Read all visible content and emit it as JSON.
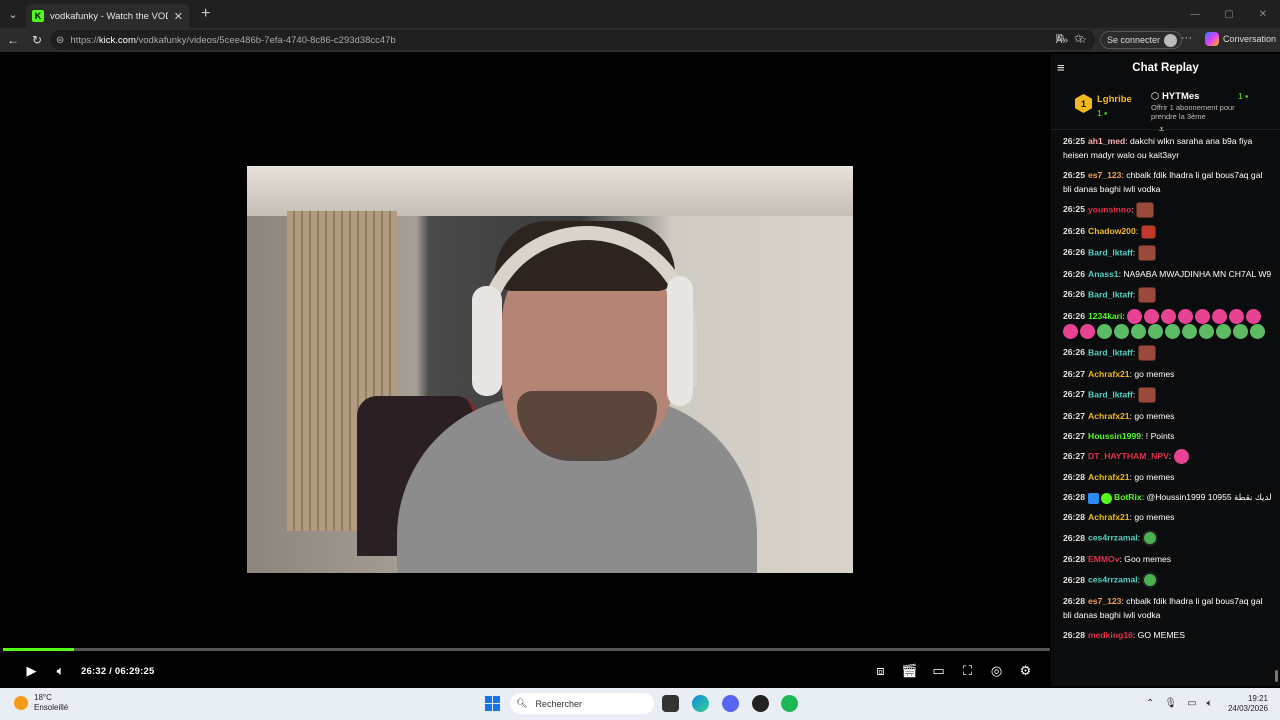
{
  "browser": {
    "tab_title": "vodkafunky - Watch the VOD on K",
    "tab_favicon": "K",
    "url_prefix": "https://",
    "url_domain": "kick.com",
    "url_path": "/vodkafunky/videos/5cee486b-7efa-4740-8c86-c293d38cc47b",
    "signin_label": "Se connecter",
    "copilot_label": "Conversation"
  },
  "player": {
    "current_time": "26:32",
    "separator": "/",
    "duration": "06:29:25",
    "progress_fraction": 0.068
  },
  "chat": {
    "title": "Chat Replay",
    "leaderboard": {
      "rank": "1",
      "name": "Lghribe",
      "count": "1"
    },
    "gifter": {
      "name": "HYTMes",
      "count": "1",
      "subtitle": "Offrir 1 abonnement pour prendre la 3ème"
    },
    "messages": [
      {
        "time": "26:25",
        "user": "ah1_med",
        "color": "#ffb0b0",
        "text": "dakchi wlkn saraha ana b9a fiya heisen madyr walo ou kait3ayr",
        "emotes": []
      },
      {
        "time": "26:25",
        "user": "es7_123",
        "color": "#f29d48",
        "text": "chbalk fdik lhadra li gal bous7aq gal bli danas baghi iwli vodka",
        "emotes": []
      },
      {
        "time": "26:25",
        "user": "younsinno",
        "color": "#e0304a",
        "text": "",
        "emotes": [
          "brown"
        ]
      },
      {
        "time": "26:26",
        "user": "Chadow200",
        "color": "#f2b81d",
        "text": "",
        "emotes": [
          "red"
        ]
      },
      {
        "time": "26:26",
        "user": "Bard_lktaff",
        "color": "#4fd1c5",
        "text": "",
        "emotes": [
          "brown"
        ]
      },
      {
        "time": "26:26",
        "user": "Anass1",
        "color": "#4fd1c5",
        "text": "NA9ABA MWAJDINHA MN CH7AL W9",
        "emotes": []
      },
      {
        "time": "26:26",
        "user": "Bard_lktaff",
        "color": "#4fd1c5",
        "text": "",
        "emotes": [
          "brown"
        ]
      },
      {
        "time": "26:26",
        "user": "1234kari",
        "color": "#53fc18",
        "text": "",
        "emotes": [
          "pink",
          "pink",
          "pink",
          "pink",
          "pink",
          "pink",
          "pink",
          "pink",
          "pink",
          "pink",
          "dollar",
          "dollar",
          "dollar",
          "dollar",
          "dollar",
          "dollar",
          "dollar",
          "dollar",
          "dollar",
          "dollar"
        ]
      },
      {
        "time": "26:26",
        "user": "Bard_lktaff",
        "color": "#4fd1c5",
        "text": "",
        "emotes": [
          "brown"
        ]
      },
      {
        "time": "26:27",
        "user": "Achrafx21",
        "color": "#f2b81d",
        "text": "go memes",
        "emotes": []
      },
      {
        "time": "26:27",
        "user": "Bard_lktaff",
        "color": "#4fd1c5",
        "text": "",
        "emotes": [
          "brown"
        ]
      },
      {
        "time": "26:27",
        "user": "Achrafx21",
        "color": "#f2b81d",
        "text": "go memes",
        "emotes": []
      },
      {
        "time": "26:27",
        "user": "Houssin1999",
        "color": "#53fc18",
        "text": "! Points",
        "emotes": []
      },
      {
        "time": "26:27",
        "user": "DT_HAYTHAM_NPV",
        "color": "#e0304a",
        "text": "",
        "emotes": [
          "pink"
        ]
      },
      {
        "time": "26:28",
        "user": "Achrafx21",
        "color": "#f2b81d",
        "text": "go memes",
        "emotes": []
      },
      {
        "time": "26:28",
        "user": "BotRix",
        "color": "#53fc18",
        "text": "@Houssin1999 10955 لديك نقطة",
        "emotes": [],
        "badges": true
      },
      {
        "time": "26:28",
        "user": "Achrafx21",
        "color": "#f2b81d",
        "text": "go memes",
        "emotes": []
      },
      {
        "time": "26:28",
        "user": "ces4rrzamal",
        "color": "#4fd1c5",
        "text": "",
        "emotes": [
          "globe"
        ]
      },
      {
        "time": "26:28",
        "user": "EMMOv",
        "color": "#e0304a",
        "text": "Goo memes",
        "emotes": []
      },
      {
        "time": "26:28",
        "user": "ces4rrzamal",
        "color": "#4fd1c5",
        "text": "",
        "emotes": [
          "globe"
        ]
      },
      {
        "time": "26:28",
        "user": "es7_123",
        "color": "#f29d48",
        "text": "chbalk fdik lhadra li gal bous7aq gal bli danas baghi iwli vodka",
        "emotes": []
      },
      {
        "time": "26:28",
        "user": "medking16",
        "color": "#e0304a",
        "text": "GO MEMES",
        "emotes": []
      }
    ]
  },
  "taskbar": {
    "temp": "18°C",
    "weather": "Ensoleillé",
    "search_placeholder": "Rechercher",
    "time": "19:21",
    "date": "24/03/2026"
  }
}
